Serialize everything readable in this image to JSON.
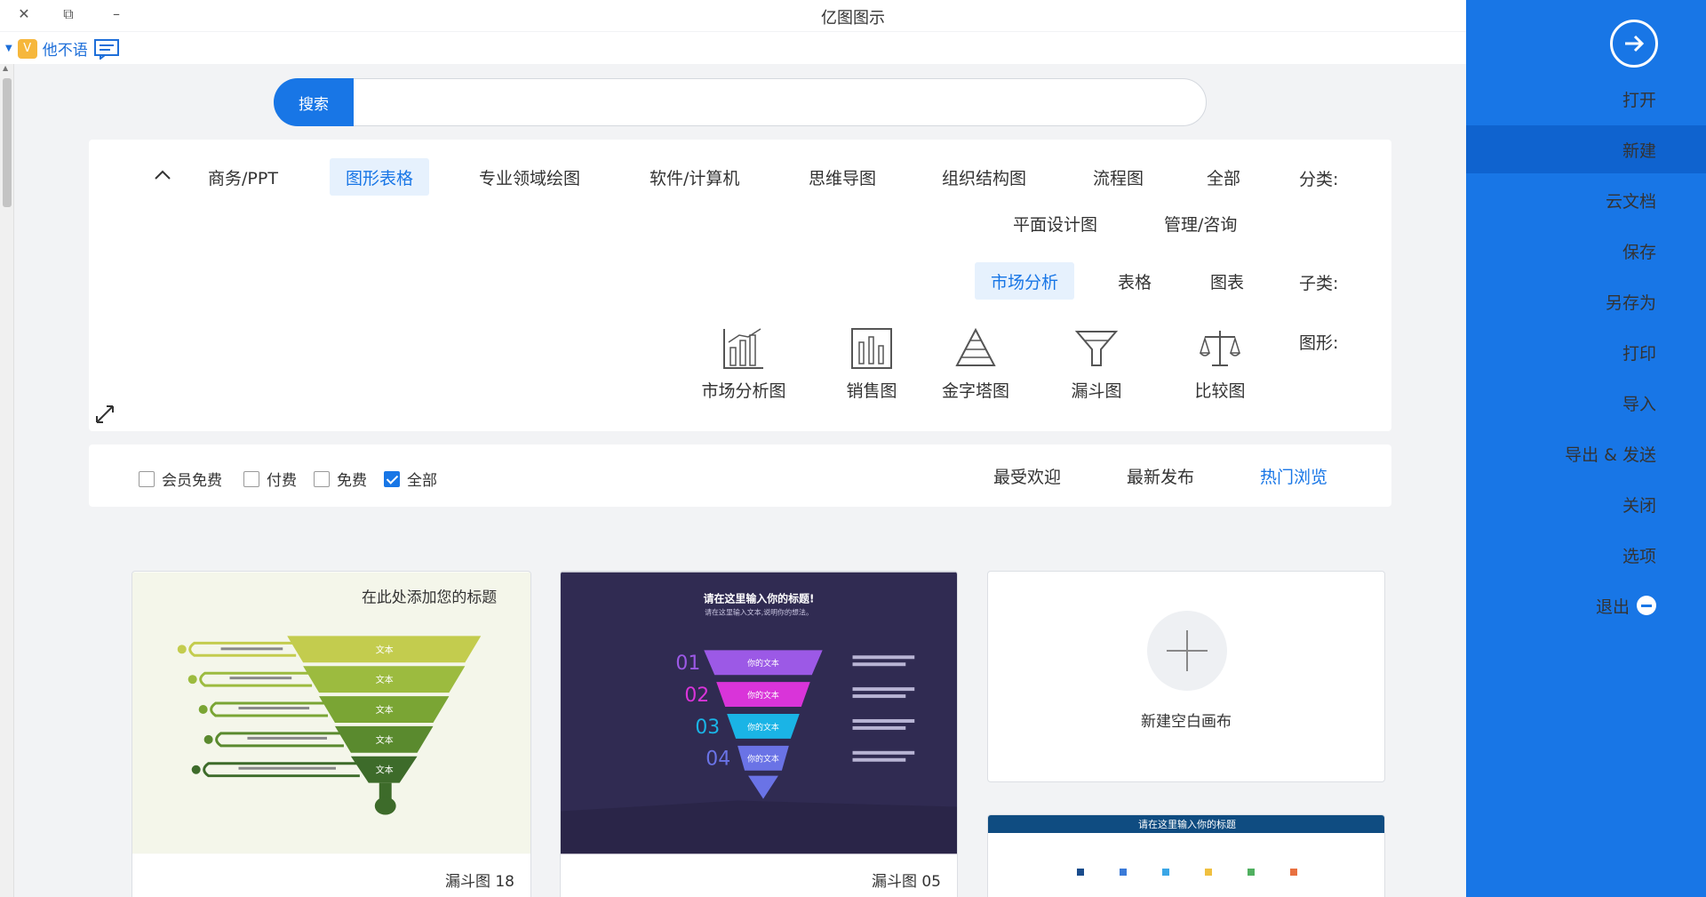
{
  "app": {
    "title": "亿图图示",
    "user_name": "他不语"
  },
  "search": {
    "button_label": "搜索",
    "placeholder": ""
  },
  "filter": {
    "category_label": "分类:",
    "categories": [
      "全部",
      "流程图",
      "组织结构图",
      "思维导图",
      "软件/计算机",
      "专业领域绘图",
      "图形表格",
      "商务/PPT",
      "管理/咨询",
      "平面设计图"
    ],
    "selected_category": "图形表格",
    "subcategory_label": "子类:",
    "subcategories": [
      "图表",
      "表格",
      "市场分析"
    ],
    "selected_subcategory": "市场分析",
    "shape_label": "图形:",
    "shapes": [
      "比较图",
      "漏斗图",
      "金字塔图",
      "销售图",
      "市场分析图"
    ]
  },
  "sort": {
    "options": [
      "热门浏览",
      "最新发布",
      "最受欢迎"
    ],
    "selected": "热门浏览",
    "price_filters": [
      "全部",
      "免费",
      "付费",
      "会员免费"
    ],
    "selected_price": "全部"
  },
  "templates": {
    "new_canvas_label": "新建空白画布",
    "items": [
      {
        "title": "漏斗图 05"
      },
      {
        "title": "漏斗图 18"
      }
    ],
    "funnel05": {
      "heading": "请在这里输入你的标题!",
      "subheading": "请在这里输入文本,说明你的想法。",
      "levels": [
        {
          "num": "01",
          "label": "你的文本",
          "color": "#9c59e6"
        },
        {
          "num": "02",
          "label": "你的文本",
          "color": "#d934d9"
        },
        {
          "num": "03",
          "label": "你的文本",
          "color": "#1ab4e6"
        },
        {
          "num": "04",
          "label": "你的文本",
          "color": "#6a73e6"
        }
      ]
    },
    "funnel18": {
      "heading": "在此处添加您的标题",
      "levels": [
        {
          "label": "文本",
          "color": "#c3cc4e"
        },
        {
          "label": "文本",
          "color": "#9cbb3f"
        },
        {
          "label": "文本",
          "color": "#7aa534"
        },
        {
          "label": "文本",
          "color": "#5a8a2e"
        },
        {
          "label": "文本",
          "color": "#3d6b2a"
        }
      ]
    },
    "partial_card_heading": "请在这里输入你的标题"
  },
  "sidebar": {
    "items": [
      "打开",
      "新建",
      "云文档",
      "保存",
      "另存为",
      "打印",
      "导入",
      "导出 & 发送",
      "关闭",
      "选项",
      "退出"
    ],
    "selected": "新建"
  },
  "colors": {
    "accent": "#1876e6",
    "sidebar": "#1876e6",
    "sidebar_active": "#0f63cf"
  }
}
